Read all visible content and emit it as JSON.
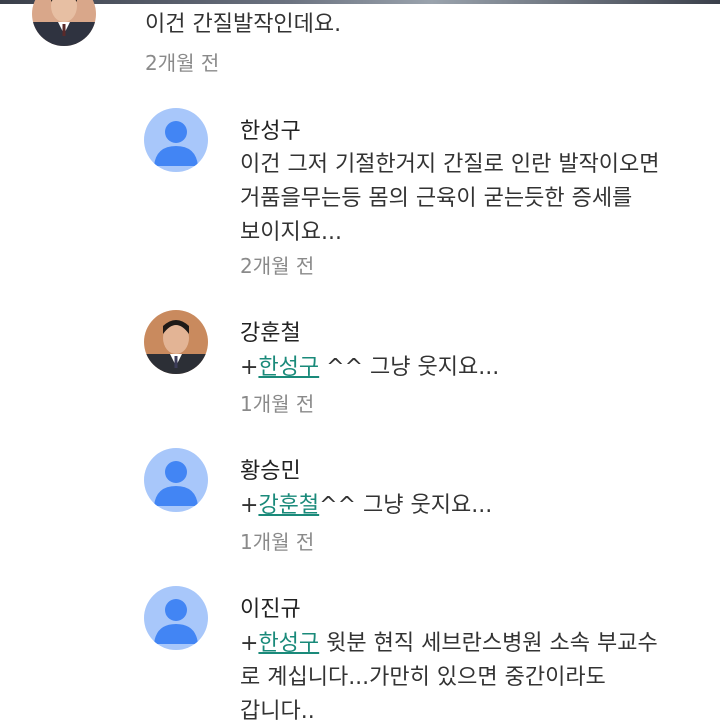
{
  "comments": [
    {
      "avatar": "photo-avatar-icon",
      "author": "",
      "lines": [
        "이건 간질발작인데요."
      ],
      "time": "2개월 전"
    },
    {
      "avatar": "default-person-icon",
      "author": "한성구",
      "lines": [
        "이건 그저 기절한거지 간질로 인란 발작이오면",
        "거품을무는등 몸의 근육이 굳는듯한 증세를",
        "보이지요..."
      ],
      "time": "2개월 전"
    },
    {
      "avatar": "photo-avatar-icon",
      "author": "강훈철",
      "plus": "+",
      "mention": "한성구",
      "after_mention": " ^^ 그냥 웃지요...",
      "time": "1개월 전"
    },
    {
      "avatar": "default-person-icon",
      "author": "황승민",
      "plus": "+",
      "mention": "강훈철",
      "after_mention": "^^ 그냥 웃지요...",
      "time": "1개월 전"
    },
    {
      "avatar": "default-person-icon",
      "author": "이진규",
      "plus": "+",
      "mention": "한성구",
      "after_mention": " 윗분 현직 세브란스병원 소속 부교수",
      "lines": [
        "로 계십니다...가만히 있으면 중간이라도",
        "갑니다.."
      ]
    }
  ],
  "colors": {
    "mention": "#1a8a7a",
    "default_avatar_bg": "#a8c7fa",
    "default_avatar_fg": "#4285f4",
    "timestamp": "#8a8a8a"
  }
}
